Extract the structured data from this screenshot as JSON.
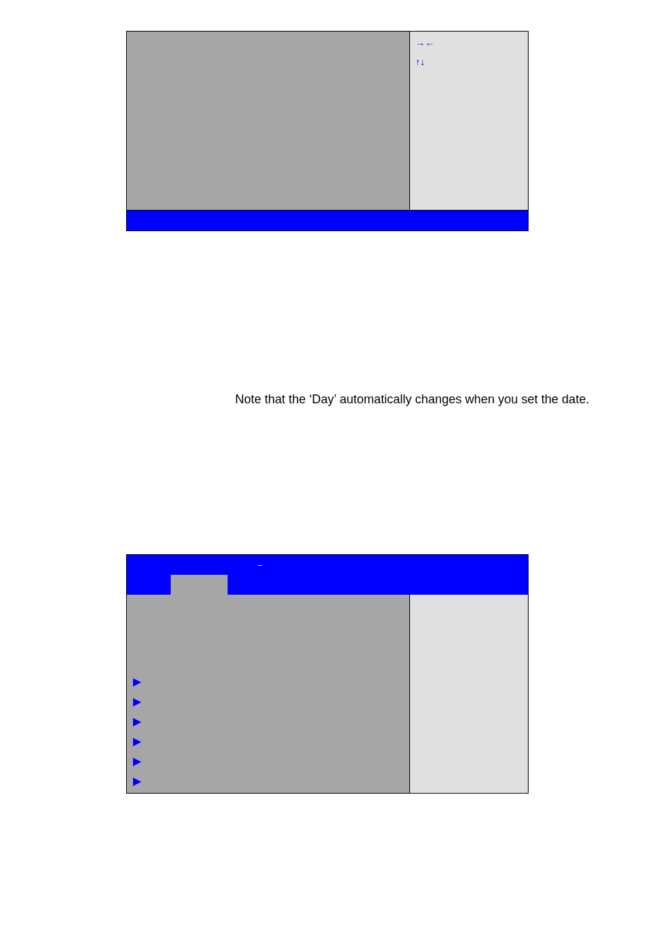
{
  "setup_screen_1": {
    "help_keys": [
      "→←",
      "↑↓"
    ]
  },
  "note": "Note that the ‘Day’ automatically changes when you set the date.",
  "setup_screen_2": {
    "title": "–",
    "tabs": [
      {
        "selected": true
      }
    ],
    "submenu_markers": [
      "▶",
      "▶",
      "▶",
      "▶",
      "▶",
      "▶"
    ]
  }
}
